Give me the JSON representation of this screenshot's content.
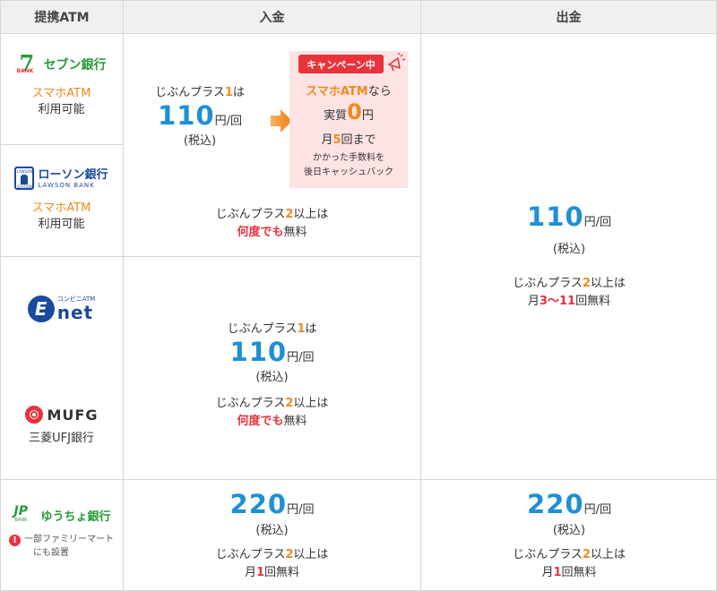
{
  "header": {
    "col1": "提携ATM",
    "col2": "入金",
    "col3": "出金"
  },
  "seven": {
    "logo_text": "セブン銀行",
    "logo_mark": "7",
    "logo_mark_small": "BANK",
    "note_line1": "スマホATM",
    "note_line2": "利用可能"
  },
  "lawson": {
    "logo_text": "ローソン銀行",
    "logo_sub": "LAWSON BANK",
    "logo_mark_small": "LAWSON",
    "logo_mark_bottom": "STATION",
    "note_line1": "スマホATM",
    "note_line2": "利用可能"
  },
  "enet": {
    "logo_e": "E",
    "logo_net": "net",
    "logo_small": "コンビニATM"
  },
  "mufg": {
    "logo_text": "MUFG",
    "bank_name": "三菱UFJ銀行"
  },
  "yucho": {
    "logo_mark": "JP",
    "logo_mark_small": "BANK",
    "logo_text": "ゆうちょ銀行",
    "note_line1": "一部ファミリーマート",
    "note_line2": "にも設置",
    "note_icon_text": "!"
  },
  "deposit_seven_lawson": {
    "plus1_a": "じぶんプラス",
    "plus1_num": "1",
    "plus1_b": "は",
    "price": "110",
    "unit": "円/回",
    "tax": "(税込)",
    "campaign": {
      "badge": "キャンペーン中",
      "line1_a": "スマホATM",
      "line1_b": "なら",
      "line2_a": "実質",
      "line2_num": "0",
      "line2_b": "円",
      "line3_a": "月",
      "line3_num": "5",
      "line3_b": "回まで",
      "line4": "かかった手数料を",
      "line5": "後日キャッシュバック"
    },
    "plus2_a": "じぶんプラス",
    "plus2_num": "2",
    "plus2_b": "以上は",
    "free_a": "何度でも",
    "free_b": "無料"
  },
  "deposit_enet_mufg": {
    "plus1_a": "じぶんプラス",
    "plus1_num": "1",
    "plus1_b": "は",
    "price": "110",
    "unit": "円/回",
    "tax": "(税込)",
    "plus2_a": "じぶんプラス",
    "plus2_num": "2",
    "plus2_b": "以上は",
    "free_a": "何度でも",
    "free_b": "無料"
  },
  "withdraw_main": {
    "price": "110",
    "unit": "円/回",
    "tax": "(税込)",
    "plus2_a": "じぶんプラス",
    "plus2_num": "2",
    "plus2_b": "以上は",
    "month_a": "月",
    "month_num1": "3",
    "month_sep": "～",
    "month_num2": "11",
    "month_b": "回無料"
  },
  "deposit_yucho": {
    "price": "220",
    "unit": "円/回",
    "tax": "(税込)",
    "plus2_a": "じぶんプラス",
    "plus2_num": "2",
    "plus2_b": "以上は",
    "month_a": "月",
    "month_num": "1",
    "month_b": "回無料"
  },
  "withdraw_yucho": {
    "price": "220",
    "unit": "円/回",
    "tax": "(税込)",
    "plus2_a": "じぶんプラス",
    "plus2_num": "2",
    "plus2_b": "以上は",
    "month_a": "月",
    "month_num": "1",
    "month_b": "回無料"
  },
  "colors": {
    "blue": "#1f8fd6",
    "orange": "#ef8a1f",
    "red": "#e8323c",
    "campaign_bg": "#fde3e3",
    "header_bg": "#f0f0f0"
  }
}
